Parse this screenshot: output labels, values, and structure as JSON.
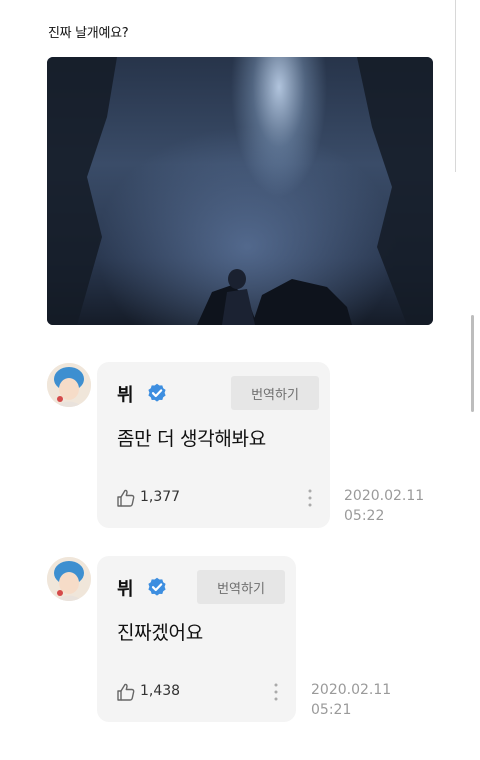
{
  "post": {
    "question": "진짜 날개예요?"
  },
  "comments": [
    {
      "author": "뷔",
      "verified": true,
      "translate_label": "번역하기",
      "message": "좀만 더 생각해봐요",
      "likes": "1,377",
      "date": "2020.02.11",
      "time": "05:22"
    },
    {
      "author": "뷔",
      "verified": true,
      "translate_label": "번역하기",
      "message": "진짜겠어요",
      "likes": "1,438",
      "date": "2020.02.11",
      "time": "05:21"
    }
  ],
  "colors": {
    "verified_badge": "#3d8ee0",
    "bubble_bg": "#f4f4f4",
    "translate_bg": "#e6e6e6",
    "timestamp": "#9a9a9a"
  }
}
